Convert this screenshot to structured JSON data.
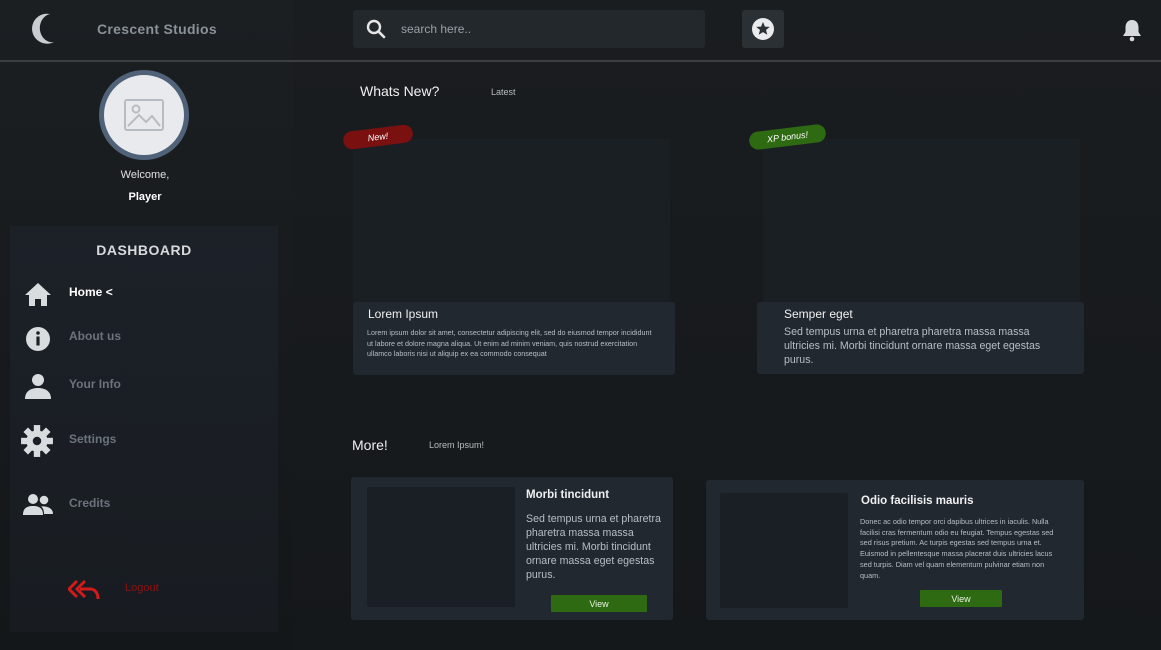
{
  "app": {
    "brand": "Crescent Studios"
  },
  "header": {
    "search_placeholder": "search here..",
    "icons": [
      "crescent-moon-icon",
      "search-icon",
      "star-icon",
      "bell-icon"
    ]
  },
  "profile": {
    "welcome": "Welcome,",
    "name": "Player"
  },
  "sidebar": {
    "title": "DASHBOARD",
    "items": [
      {
        "label": "Home",
        "icon": "home-icon",
        "active": true,
        "suffix": "<"
      },
      {
        "label": "About us",
        "icon": "info-icon",
        "active": false
      },
      {
        "label": "Your Info",
        "icon": "user-icon",
        "active": false
      },
      {
        "label": "Settings",
        "icon": "gear-icon",
        "active": false
      },
      {
        "label": "Credits",
        "icon": "users-icon",
        "active": false
      }
    ],
    "logout": {
      "label": "Logout",
      "icon": "logout-arrows-icon"
    }
  },
  "whats_new": {
    "title": "Whats New?",
    "subtitle": "Latest",
    "cards": [
      {
        "badge": "New!",
        "badge_color": "#7a1010",
        "title": "Lorem Ipsum",
        "text": "Lorem ipsum dolor sit amet, consectetur adipiscing elit, sed do eiusmod tempor incididunt ut labore et dolore magna aliqua. Ut enim ad minim veniam, quis nostrud exercitation ullamco laboris nisi ut aliquip ex ea commodo consequat"
      },
      {
        "badge": "XP bonus!",
        "badge_color": "#2e6a12",
        "title": "Semper eget",
        "text": "Sed tempus urna et pharetra pharetra massa massa ultricies mi. Morbi tincidunt ornare massa eget egestas purus."
      }
    ]
  },
  "more": {
    "title": "More!",
    "subtitle": "Lorem Ipsum!",
    "cards": [
      {
        "title": "Morbi tincidunt",
        "text": "Sed tempus urna et pharetra pharetra massa massa ultricies mi. Morbi tincidunt ornare massa eget egestas purus.",
        "button": "View"
      },
      {
        "title": "Odio facilisis mauris",
        "text": "Donec ac odio tempor orci dapibus ultrices in iaculis. Nulla facilisi cras fermentum odio eu feugiat. Tempus egestas sed sed risus pretium. Ac turpis egestas sed tempus urna et. Euismod in pellentesque massa placerat duis ultricies lacus sed turpis. Diam vel quam elementum pulvinar etiam non quam.",
        "button": "View"
      }
    ]
  },
  "colors": {
    "accent_green": "#2e6a12",
    "badge_red": "#7a1010",
    "avatar_ring": "#4f6278",
    "logout_red": "#c41a1a"
  }
}
